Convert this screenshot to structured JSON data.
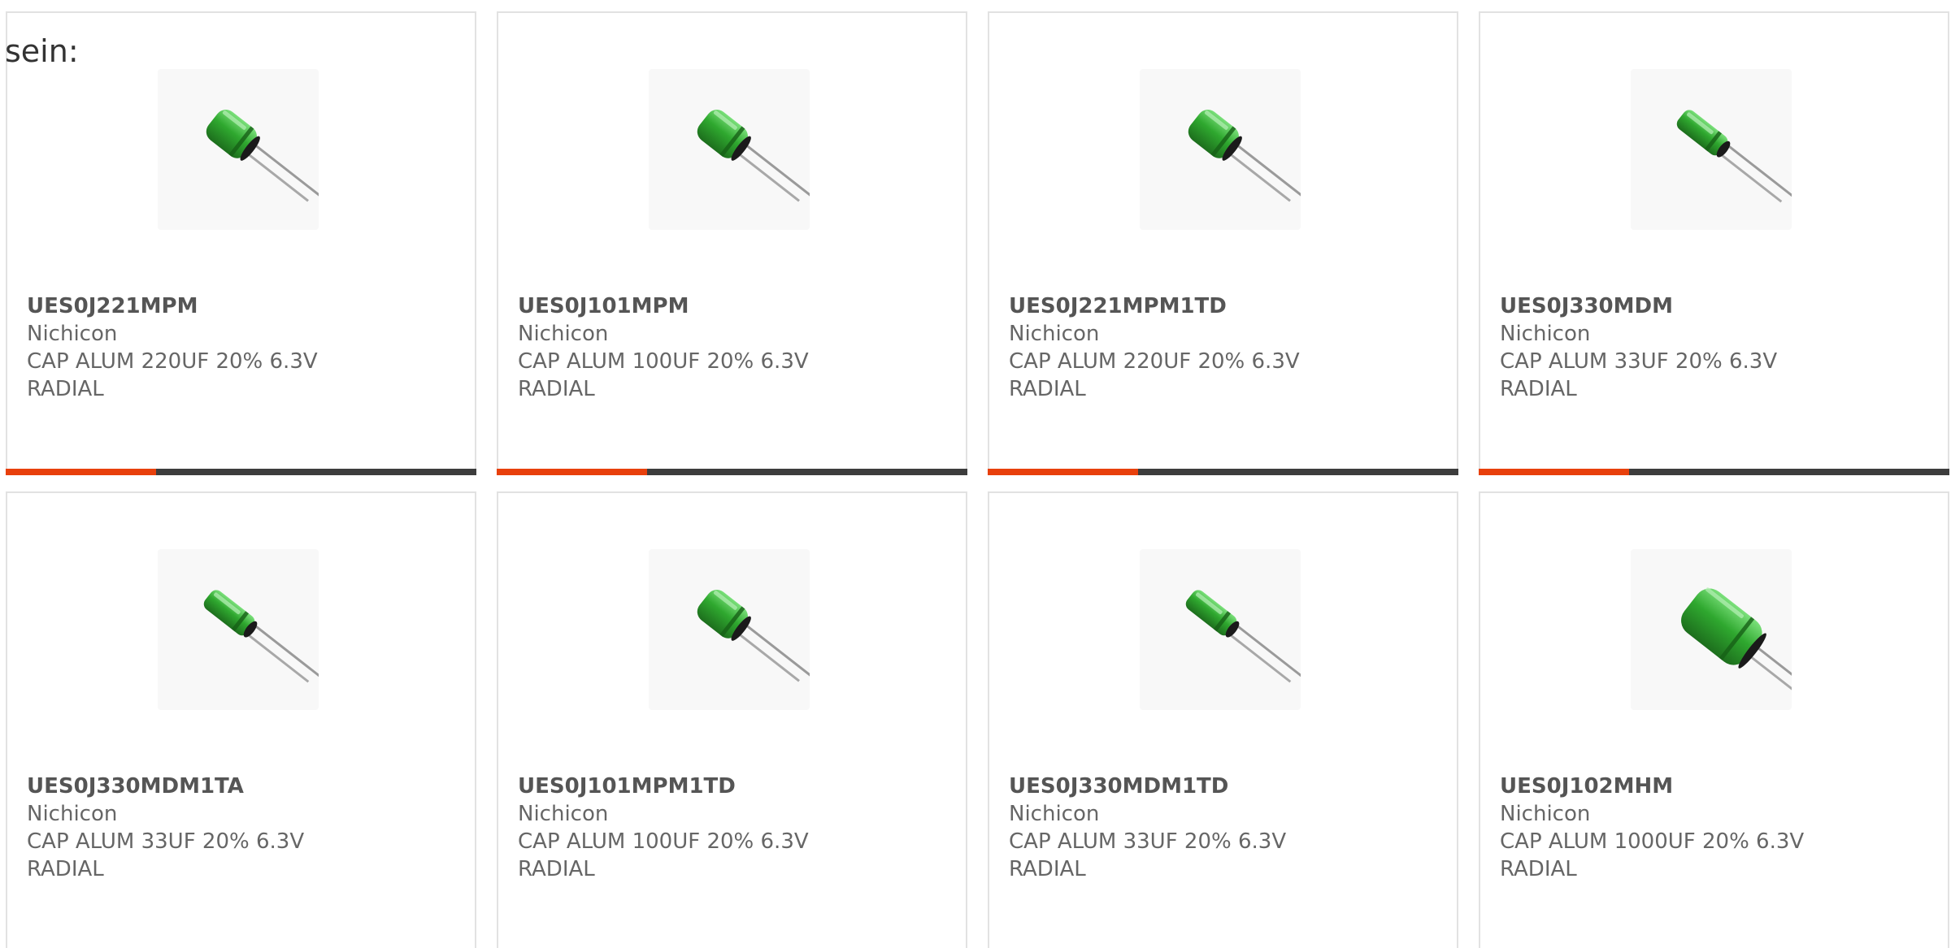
{
  "intro_text": "sein:",
  "colors": {
    "accent": "#e8400c",
    "bar_track": "#3d3d3d",
    "card_border": "#e2e2e2",
    "text": "#666666",
    "capacitor": "#2fa82f"
  },
  "cards": [
    {
      "part": "UES0J221MPM",
      "manufacturer": "Nichicon",
      "description": "CAP ALUM 220UF 20% 6.3V RADIAL",
      "image": "capacitor-image",
      "progress": 0.32
    },
    {
      "part": "UES0J101MPM",
      "manufacturer": "Nichicon",
      "description": "CAP ALUM 100UF 20% 6.3V RADIAL",
      "image": "capacitor-image",
      "progress": 0.32
    },
    {
      "part": "UES0J221MPM1TD",
      "manufacturer": "Nichicon",
      "description": "CAP ALUM 220UF 20% 6.3V RADIAL",
      "image": "capacitor-image",
      "progress": 0.32
    },
    {
      "part": "UES0J330MDM",
      "manufacturer": "Nichicon",
      "description": "CAP ALUM 33UF 20% 6.3V RADIAL",
      "image": "capacitor-image",
      "progress": 0.32
    },
    {
      "part": "UES0J330MDM1TA",
      "manufacturer": "Nichicon",
      "description": "CAP ALUM 33UF 20% 6.3V RADIAL",
      "image": "capacitor-image"
    },
    {
      "part": "UES0J101MPM1TD",
      "manufacturer": "Nichicon",
      "description": "CAP ALUM 100UF 20% 6.3V RADIAL",
      "image": "capacitor-image"
    },
    {
      "part": "UES0J330MDM1TD",
      "manufacturer": "Nichicon",
      "description": "CAP ALUM 33UF 20% 6.3V RADIAL",
      "image": "capacitor-image"
    },
    {
      "part": "UES0J102MHM",
      "manufacturer": "Nichicon",
      "description": "CAP ALUM 1000UF 20% 6.3V RADIAL",
      "image": "capacitor-image"
    }
  ]
}
